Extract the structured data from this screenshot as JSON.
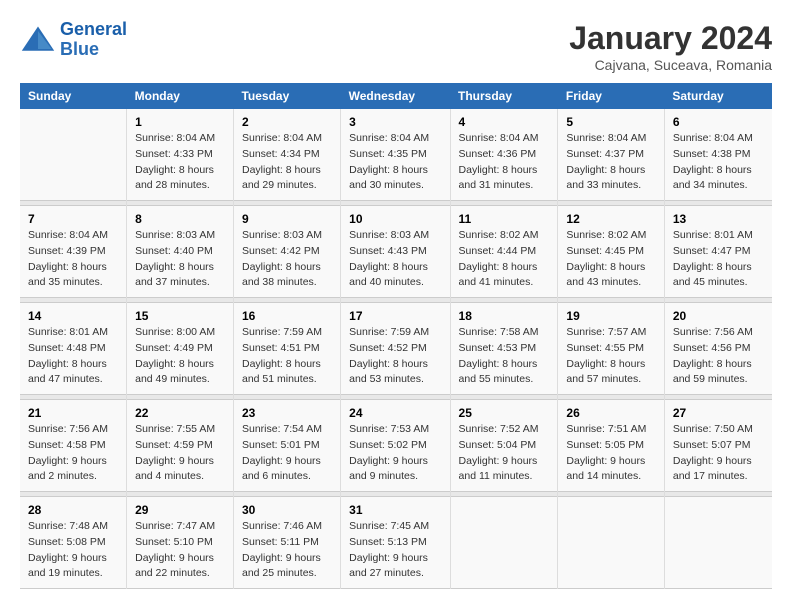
{
  "header": {
    "logo_line1": "General",
    "logo_line2": "Blue",
    "month": "January 2024",
    "location": "Cajvana, Suceava, Romania"
  },
  "days_of_week": [
    "Sunday",
    "Monday",
    "Tuesday",
    "Wednesday",
    "Thursday",
    "Friday",
    "Saturday"
  ],
  "weeks": [
    [
      {
        "num": "",
        "sunrise": "",
        "sunset": "",
        "daylight": ""
      },
      {
        "num": "1",
        "sunrise": "Sunrise: 8:04 AM",
        "sunset": "Sunset: 4:33 PM",
        "daylight": "Daylight: 8 hours and 28 minutes."
      },
      {
        "num": "2",
        "sunrise": "Sunrise: 8:04 AM",
        "sunset": "Sunset: 4:34 PM",
        "daylight": "Daylight: 8 hours and 29 minutes."
      },
      {
        "num": "3",
        "sunrise": "Sunrise: 8:04 AM",
        "sunset": "Sunset: 4:35 PM",
        "daylight": "Daylight: 8 hours and 30 minutes."
      },
      {
        "num": "4",
        "sunrise": "Sunrise: 8:04 AM",
        "sunset": "Sunset: 4:36 PM",
        "daylight": "Daylight: 8 hours and 31 minutes."
      },
      {
        "num": "5",
        "sunrise": "Sunrise: 8:04 AM",
        "sunset": "Sunset: 4:37 PM",
        "daylight": "Daylight: 8 hours and 33 minutes."
      },
      {
        "num": "6",
        "sunrise": "Sunrise: 8:04 AM",
        "sunset": "Sunset: 4:38 PM",
        "daylight": "Daylight: 8 hours and 34 minutes."
      }
    ],
    [
      {
        "num": "7",
        "sunrise": "Sunrise: 8:04 AM",
        "sunset": "Sunset: 4:39 PM",
        "daylight": "Daylight: 8 hours and 35 minutes."
      },
      {
        "num": "8",
        "sunrise": "Sunrise: 8:03 AM",
        "sunset": "Sunset: 4:40 PM",
        "daylight": "Daylight: 8 hours and 37 minutes."
      },
      {
        "num": "9",
        "sunrise": "Sunrise: 8:03 AM",
        "sunset": "Sunset: 4:42 PM",
        "daylight": "Daylight: 8 hours and 38 minutes."
      },
      {
        "num": "10",
        "sunrise": "Sunrise: 8:03 AM",
        "sunset": "Sunset: 4:43 PM",
        "daylight": "Daylight: 8 hours and 40 minutes."
      },
      {
        "num": "11",
        "sunrise": "Sunrise: 8:02 AM",
        "sunset": "Sunset: 4:44 PM",
        "daylight": "Daylight: 8 hours and 41 minutes."
      },
      {
        "num": "12",
        "sunrise": "Sunrise: 8:02 AM",
        "sunset": "Sunset: 4:45 PM",
        "daylight": "Daylight: 8 hours and 43 minutes."
      },
      {
        "num": "13",
        "sunrise": "Sunrise: 8:01 AM",
        "sunset": "Sunset: 4:47 PM",
        "daylight": "Daylight: 8 hours and 45 minutes."
      }
    ],
    [
      {
        "num": "14",
        "sunrise": "Sunrise: 8:01 AM",
        "sunset": "Sunset: 4:48 PM",
        "daylight": "Daylight: 8 hours and 47 minutes."
      },
      {
        "num": "15",
        "sunrise": "Sunrise: 8:00 AM",
        "sunset": "Sunset: 4:49 PM",
        "daylight": "Daylight: 8 hours and 49 minutes."
      },
      {
        "num": "16",
        "sunrise": "Sunrise: 7:59 AM",
        "sunset": "Sunset: 4:51 PM",
        "daylight": "Daylight: 8 hours and 51 minutes."
      },
      {
        "num": "17",
        "sunrise": "Sunrise: 7:59 AM",
        "sunset": "Sunset: 4:52 PM",
        "daylight": "Daylight: 8 hours and 53 minutes."
      },
      {
        "num": "18",
        "sunrise": "Sunrise: 7:58 AM",
        "sunset": "Sunset: 4:53 PM",
        "daylight": "Daylight: 8 hours and 55 minutes."
      },
      {
        "num": "19",
        "sunrise": "Sunrise: 7:57 AM",
        "sunset": "Sunset: 4:55 PM",
        "daylight": "Daylight: 8 hours and 57 minutes."
      },
      {
        "num": "20",
        "sunrise": "Sunrise: 7:56 AM",
        "sunset": "Sunset: 4:56 PM",
        "daylight": "Daylight: 8 hours and 59 minutes."
      }
    ],
    [
      {
        "num": "21",
        "sunrise": "Sunrise: 7:56 AM",
        "sunset": "Sunset: 4:58 PM",
        "daylight": "Daylight: 9 hours and 2 minutes."
      },
      {
        "num": "22",
        "sunrise": "Sunrise: 7:55 AM",
        "sunset": "Sunset: 4:59 PM",
        "daylight": "Daylight: 9 hours and 4 minutes."
      },
      {
        "num": "23",
        "sunrise": "Sunrise: 7:54 AM",
        "sunset": "Sunset: 5:01 PM",
        "daylight": "Daylight: 9 hours and 6 minutes."
      },
      {
        "num": "24",
        "sunrise": "Sunrise: 7:53 AM",
        "sunset": "Sunset: 5:02 PM",
        "daylight": "Daylight: 9 hours and 9 minutes."
      },
      {
        "num": "25",
        "sunrise": "Sunrise: 7:52 AM",
        "sunset": "Sunset: 5:04 PM",
        "daylight": "Daylight: 9 hours and 11 minutes."
      },
      {
        "num": "26",
        "sunrise": "Sunrise: 7:51 AM",
        "sunset": "Sunset: 5:05 PM",
        "daylight": "Daylight: 9 hours and 14 minutes."
      },
      {
        "num": "27",
        "sunrise": "Sunrise: 7:50 AM",
        "sunset": "Sunset: 5:07 PM",
        "daylight": "Daylight: 9 hours and 17 minutes."
      }
    ],
    [
      {
        "num": "28",
        "sunrise": "Sunrise: 7:48 AM",
        "sunset": "Sunset: 5:08 PM",
        "daylight": "Daylight: 9 hours and 19 minutes."
      },
      {
        "num": "29",
        "sunrise": "Sunrise: 7:47 AM",
        "sunset": "Sunset: 5:10 PM",
        "daylight": "Daylight: 9 hours and 22 minutes."
      },
      {
        "num": "30",
        "sunrise": "Sunrise: 7:46 AM",
        "sunset": "Sunset: 5:11 PM",
        "daylight": "Daylight: 9 hours and 25 minutes."
      },
      {
        "num": "31",
        "sunrise": "Sunrise: 7:45 AM",
        "sunset": "Sunset: 5:13 PM",
        "daylight": "Daylight: 9 hours and 27 minutes."
      },
      {
        "num": "",
        "sunrise": "",
        "sunset": "",
        "daylight": ""
      },
      {
        "num": "",
        "sunrise": "",
        "sunset": "",
        "daylight": ""
      },
      {
        "num": "",
        "sunrise": "",
        "sunset": "",
        "daylight": ""
      }
    ]
  ]
}
